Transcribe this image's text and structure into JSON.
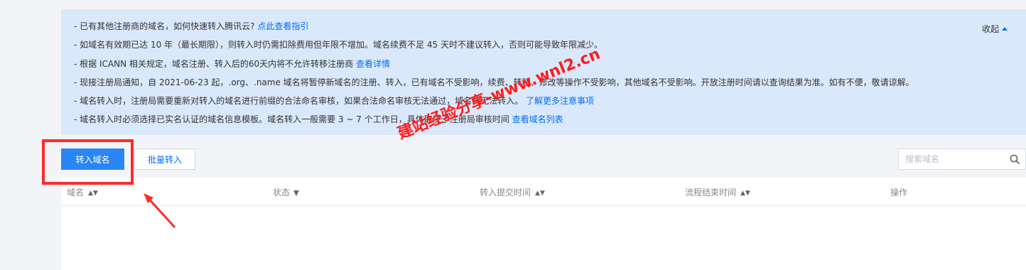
{
  "notice": {
    "lines": [
      {
        "text": "- 已有其他注册商的域名，如何快速转入腾讯云?",
        "link": "点此查看指引"
      },
      {
        "text": "- 如域名有效期已达 10 年（最长期限），则转入时仍需扣除费用但年限不增加。域名续费不足 45 天时不建议转入，否则可能导致年限减少。",
        "link": ""
      },
      {
        "text": "- 根据 ICANN 相关规定，域名注册、转入后的60天内将不允许转移注册商",
        "link": "查看详情"
      },
      {
        "text": "- 现接注册局通知，自 2021-06-23 起，.org、.name 域名将暂停新域名的注册、转入，已有域名不受影响，续费、转移、修改等操作不受影响，其他域名不受影响。开放注册时间请以查询结果为准。如有不便，敬请谅解。",
        "link": ""
      },
      {
        "text": "- 域名转入时，注册局需要重新对转入的域名进行前缀的合法命名审核，如果合法命名审核无法通过，域名将无法转入。",
        "link": "了解更多注意事项"
      },
      {
        "text": "- 域名转入时必须选择已实名认证的域名信息模板。域名转入一般需要 3 ~ 7 个工作日，具体取决于注册局审核时间",
        "link": "查看域名列表"
      }
    ],
    "collapse_label": "收起"
  },
  "toolbar": {
    "transfer_label": "转入域名",
    "batch_label": "批量转入",
    "search_placeholder": "搜索域名"
  },
  "table": {
    "columns": [
      "域名",
      "状态",
      "转入提交时间",
      "流程结束时间",
      "操作"
    ]
  },
  "watermark": "建站经验分享-www.wnl2.cn",
  "colors": {
    "accent": "#006eff",
    "primary_button": "#2b86f5",
    "notice_bg": "#dae8fb",
    "highlight": "#ff2a2a"
  }
}
